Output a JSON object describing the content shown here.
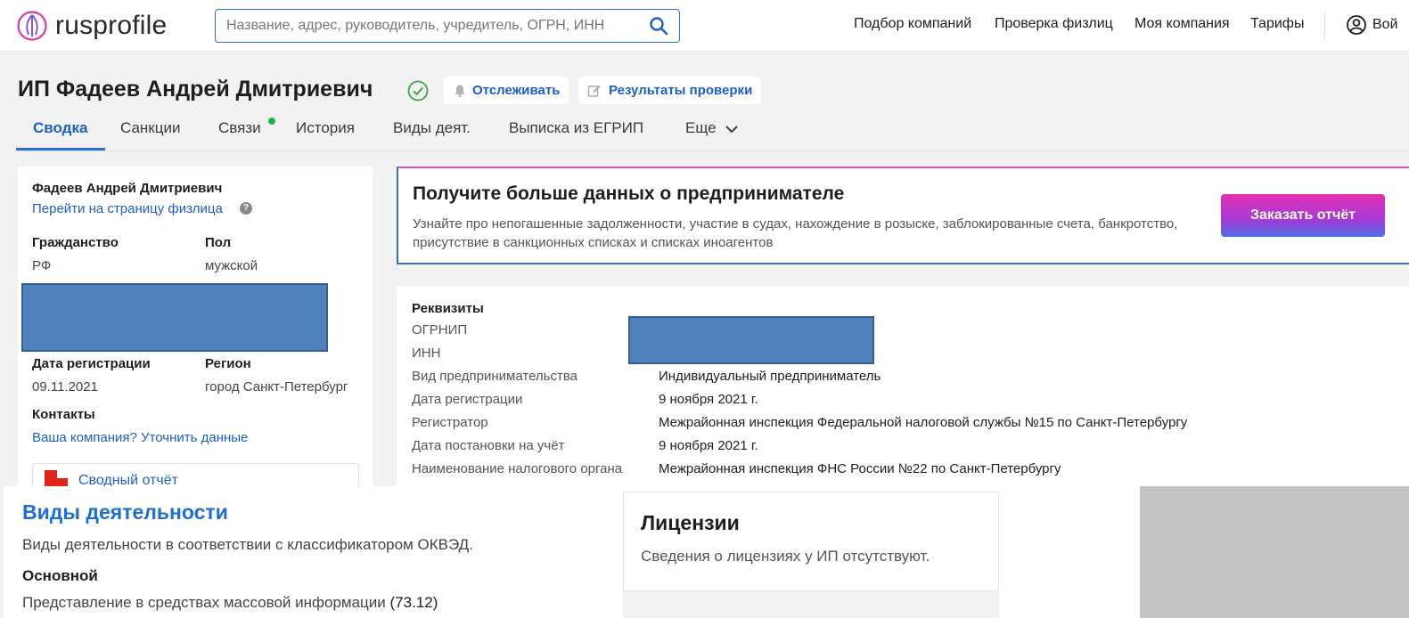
{
  "header": {
    "logo_text": "rusprofile",
    "search_placeholder": "Название, адрес, руководитель, учредитель, ОГРН, ИНН",
    "nav": [
      "Подбор компаний",
      "Проверка физлиц",
      "Моя компания",
      "Тарифы"
    ],
    "login_label": "Вой"
  },
  "title": {
    "name": "ИП Фадеев Андрей Дмитриевич",
    "track_label": "Отслеживать",
    "results_label": "Результаты проверки"
  },
  "tabs": [
    "Сводка",
    "Санкции",
    "Связи",
    "История",
    "Виды деят.",
    "Выписка из ЕГРИП",
    "Еще"
  ],
  "left_card": {
    "person_name": "Фадеев Андрей Дмитриевич",
    "person_link": "Перейти на страницу физлица",
    "citizenship_label": "Гражданство",
    "citizenship_value": "РФ",
    "gender_label": "Пол",
    "gender_value": "мужской",
    "reg_date_label": "Дата регистрации",
    "reg_date_value": "09.11.2021",
    "region_label": "Регион",
    "region_value": "город Санкт-Петербург",
    "contacts_label": "Контакты",
    "contacts_link": "Ваша компания? Уточнить данные",
    "report_link": "Сводный отчёт"
  },
  "promo": {
    "title": "Получите больше данных о предпринимателе",
    "text": "Узнайте про непогашенные задолженности, участие в судах, нахождение в розыске, заблокированные счета, банкротство, присутствие в санкционных списках и списках иноагентов",
    "button": "Заказать отчёт"
  },
  "requisites": {
    "title": "Реквизиты",
    "rows": [
      {
        "label": "ОГРНИП",
        "value": ""
      },
      {
        "label": "ИНН",
        "value": ""
      },
      {
        "label": "Вид предпринимательства",
        "value": "Индивидуальный предприниматель"
      },
      {
        "label": "Дата регистрации",
        "value": "9 ноября 2021 г."
      },
      {
        "label": "Регистратор",
        "value": "Межрайонная инспекция Федеральной налоговой службы №15 по Санкт-Петербургу"
      },
      {
        "label": "Дата постановки на учёт",
        "value": "9 ноября 2021 г."
      },
      {
        "label": "Наименование налогового органа",
        "value": "Межрайонная инспекция ФНС России №22 по Санкт-Петербургу"
      }
    ]
  },
  "activities": {
    "title": "Виды деятельности",
    "subtitle": "Виды деятельности в соответствии с классификатором ОКВЭД.",
    "main_label": "Основной",
    "main_text": "Представление в средствах массовой информации",
    "main_code": "(73.12)"
  },
  "licenses": {
    "title": "Лицензии",
    "text": "Сведения о лицензиях у ИП отсутствуют."
  },
  "colors": {
    "accent": "#1c5fc7",
    "check_green": "#3aa84a",
    "dot_green": "#22b14c",
    "redaction": "#4f81bd"
  }
}
